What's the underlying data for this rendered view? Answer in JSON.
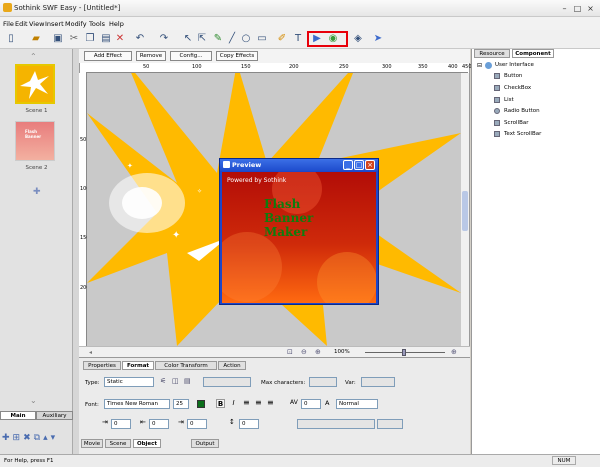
{
  "app": {
    "title": "Sothink SWF Easy - [Untitled*]"
  },
  "menu": [
    "File",
    "Edit",
    "View",
    "Insert",
    "Modify",
    "Tools",
    "Help"
  ],
  "effects": {
    "add": "Add Effect",
    "remove": "Remove",
    "config": "Config...",
    "copy": "Copy Effects"
  },
  "ruler": {
    "h": [
      "50",
      "100",
      "150",
      "200",
      "250",
      "300",
      "350",
      "400",
      "450"
    ],
    "v": [
      "50",
      "100",
      "150",
      "200"
    ]
  },
  "scenes": [
    "Scene 1",
    "Scene 2"
  ],
  "left_tabs": [
    "Main",
    "Auxiliary"
  ],
  "preview": {
    "title": "Preview",
    "powered": "Powered by Sothink",
    "banner": [
      "Flash",
      "Banner",
      "Maker"
    ]
  },
  "zoom": "100%",
  "prop_tabs": [
    "Properties",
    "Format",
    "Color Transform",
    "Action"
  ],
  "format": {
    "type_label": "Type:",
    "type_value": "Static",
    "max_chars_label": "Max characters:",
    "var_label": "Var:",
    "font_label": "Font:",
    "font_value": "Times New Roman",
    "font_size": "25",
    "bold": "B",
    "italic": "I",
    "letter_spacing": "0",
    "aa_label": "A",
    "aa_value": "Normal",
    "indent1": "0",
    "indent2": "0",
    "spacing1": "0",
    "spacing2": "0"
  },
  "bottom_tabs": [
    "Movie",
    "Scene",
    "Object",
    "Output"
  ],
  "right_tabs": [
    "Resource",
    "Component"
  ],
  "tree": {
    "root": "User Interface",
    "items": [
      "Button",
      "CheckBox",
      "List",
      "Radio Button",
      "ScrollBar",
      "Text ScrollBar"
    ]
  },
  "status": {
    "help": "For Help, press F1",
    "num": "NUM"
  },
  "colors": {
    "accent": "#ffb400",
    "highlight": "#e8000a"
  }
}
